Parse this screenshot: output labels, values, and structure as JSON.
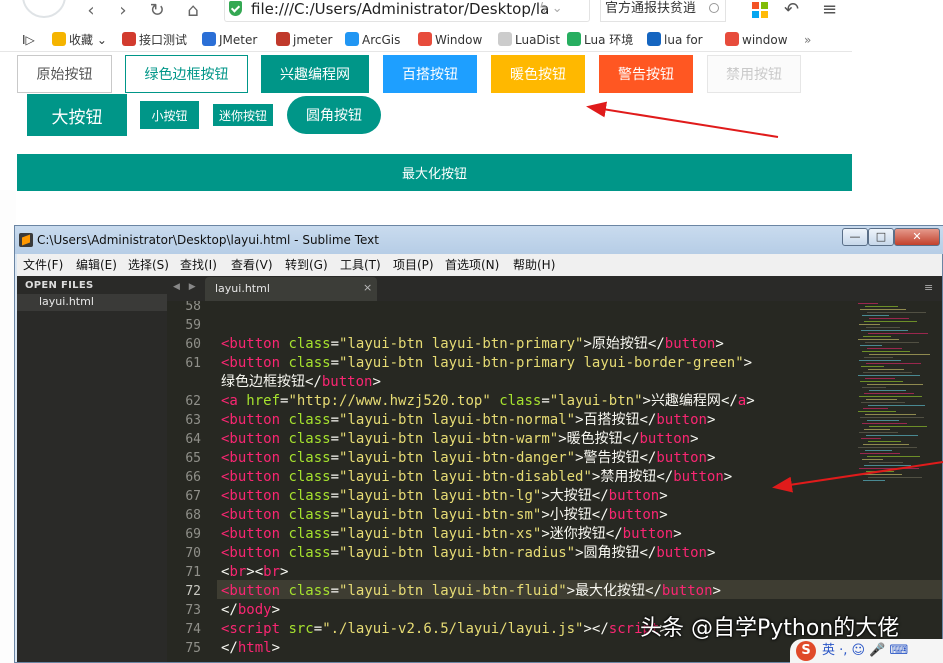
{
  "browser": {
    "address": "file:///C:/Users/Administrator/Desktop/la",
    "address_extra": "ϟ ⌄",
    "search_text": "官方通报扶贫逍",
    "nav": {
      "back": "‹",
      "forward": "›",
      "reload": "↻",
      "home": "⌂"
    },
    "bookmarks": [
      {
        "label": "收藏 ⌄",
        "icon_color": "#f5b400"
      },
      {
        "label": "接口测试",
        "icon_color": "#d23b2e"
      },
      {
        "label": "JMeter",
        "icon_color": "#2b6fd6"
      },
      {
        "label": "jmeter",
        "icon_color": "#c0392b"
      },
      {
        "label": "ArcGis",
        "icon_color": "#2196f3"
      },
      {
        "label": "Window",
        "icon_color": "#e74c3c"
      },
      {
        "label": "LuaDist",
        "icon_color": "#cccccc"
      },
      {
        "label": "Lua 环境",
        "icon_color": "#27ae60"
      },
      {
        "label": "lua for",
        "icon_color": "#1565c0"
      },
      {
        "label": "window",
        "icon_color": "#e74c3c"
      }
    ],
    "bookmarks_more": "»",
    "sidebar_toggle": "I▷"
  },
  "page": {
    "buttons": {
      "primary": "原始按钮",
      "border_green": "绿色边框按钮",
      "default": "兴趣编程网",
      "normal": "百搭按钮",
      "warm": "暖色按钮",
      "danger": "警告按钮",
      "disabled": "禁用按钮",
      "lg": "大按钮",
      "sm": "小按钮",
      "xs": "迷你按钮",
      "radius": "圆角按钮",
      "fluid": "最大化按钮"
    }
  },
  "sublime": {
    "title": "C:\\Users\\Administrator\\Desktop\\layui.html - Sublime Text",
    "window_buttons": {
      "minimize": "—",
      "maximize": "□",
      "close": "✕"
    },
    "menu": [
      "文件(F)",
      "编辑(E)",
      "选择(S)",
      "查找(I)",
      "查看(V)",
      "转到(G)",
      "工具(T)",
      "项目(P)",
      "首选项(N)",
      "帮助(H)"
    ],
    "sidebar_heading": "OPEN FILES",
    "open_file": "layui.html",
    "tab_label": "layui.html",
    "tab_close": "×",
    "tab_arrows": "◀ ▶",
    "tab_menu": "≡",
    "line_numbers": [
      "58",
      "59",
      "60",
      "61",
      "",
      "62",
      "63",
      "64",
      "65",
      "66",
      "67",
      "68",
      "69",
      "70",
      "71",
      "72",
      "73",
      "74",
      "75"
    ],
    "code": {
      "l60": "原始按钮",
      "l61": "绿色边框按钮",
      "l62": "兴趣编程网",
      "l63": "百搭按钮",
      "l64": "暖色按钮",
      "l65": "警告按钮",
      "l66": "禁用按钮",
      "l67": "大按钮",
      "l68": "小按钮",
      "l69": "迷你按钮",
      "l70": "圆角按钮",
      "l72": "最大化按钮"
    }
  },
  "watermark": "头条 @自学Python的大佬",
  "tray": {
    "ime_icon": "S",
    "text": "英 ·, ☺ 🎤 ⌨"
  },
  "colors": {
    "layui_green": "#009688",
    "layui_blue": "#1e9fff",
    "layui_warm": "#ffb800",
    "layui_danger": "#ff5722",
    "arrow_red": "#e01b1b"
  }
}
